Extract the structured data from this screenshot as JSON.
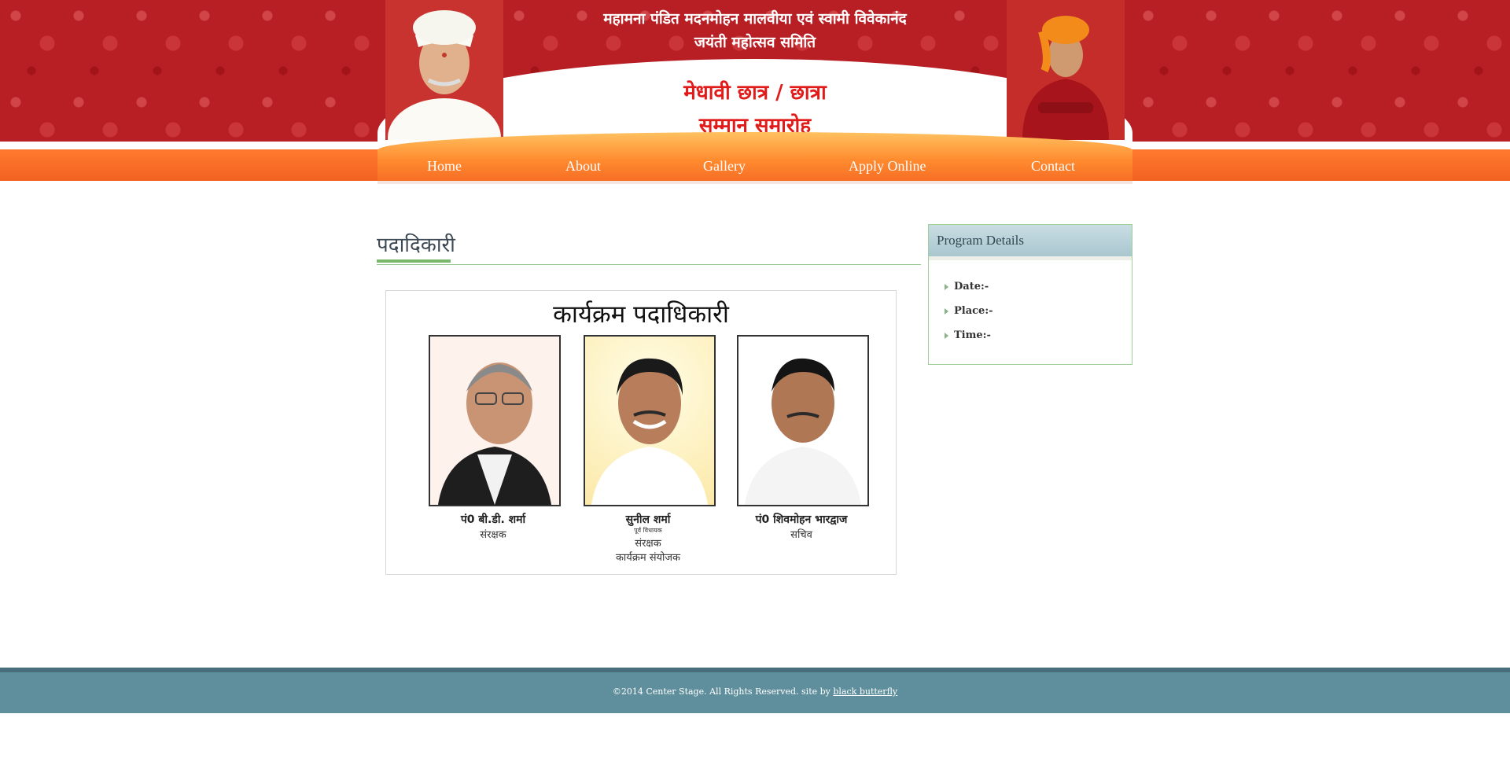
{
  "header": {
    "org_line1": "महामना पंडित मदनमोहन मालवीया एवं स्वामी विवेकानंद",
    "org_line2": "जयंती महोत्सव समिति",
    "title_line1": "मेधावी छात्र / छात्रा",
    "title_line2": "सम्मान समारोह"
  },
  "nav": {
    "items": [
      {
        "label": "Home"
      },
      {
        "label": "About"
      },
      {
        "label": "Gallery"
      },
      {
        "label": "Apply Online"
      },
      {
        "label": "Contact"
      }
    ]
  },
  "main": {
    "section_title": "पदादिकारी",
    "officials": {
      "heading": "कार्यक्रम पदाधिकारी",
      "people": [
        {
          "name": "पं0 बी.डी. शर्मा",
          "role": "संरक्षक"
        },
        {
          "name": "सुनील शर्मा",
          "subtitle": "पूर्व विधायक",
          "role": "संरक्षक",
          "role2": "कार्यक्रम संयोजक"
        },
        {
          "name": "पं0 शिवमोहन भारद्वाज",
          "role": "सचिव"
        }
      ]
    }
  },
  "sidebar": {
    "title": "Program Details",
    "items": [
      {
        "label": "Date:-"
      },
      {
        "label": "Place:-"
      },
      {
        "label": "Time:-"
      }
    ]
  },
  "footer": {
    "text": "©2014 Center Stage. All Rights Reserved. site by ",
    "link_text": "black butterfly"
  },
  "colors": {
    "header_red": "#b81f25",
    "nav_orange": "#f26222",
    "title_red": "#e11a1a",
    "footer_teal": "#5f8f9c",
    "accent_green": "#79b86b"
  }
}
